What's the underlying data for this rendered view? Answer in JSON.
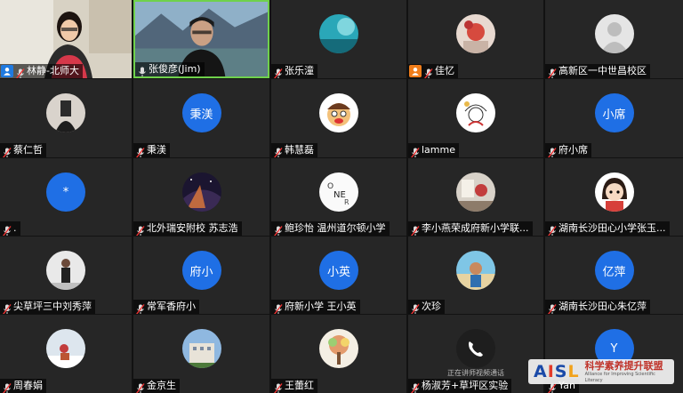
{
  "participants": [
    {
      "name": "林静-北师大",
      "kind": "video-woman",
      "host": true
    },
    {
      "name": "张俊彦(Jim)",
      "kind": "video-man",
      "active": true
    },
    {
      "name": "张乐潼",
      "kind": "photo-cyan"
    },
    {
      "name": "佳忆",
      "kind": "photo-red",
      "cohost": true
    },
    {
      "name": "高新区一中世昌校区",
      "kind": "photo-default"
    },
    {
      "name": "蔡仁哲",
      "kind": "photo-dark"
    },
    {
      "name": "秉渼",
      "kind": "text",
      "initials": "秉渼"
    },
    {
      "name": "韩慧磊",
      "kind": "photo-cartoon"
    },
    {
      "name": "lamme",
      "kind": "photo-sketch"
    },
    {
      "name": "府小席",
      "kind": "text",
      "initials": "小席"
    },
    {
      "name": ".",
      "kind": "text",
      "initials": "*"
    },
    {
      "name": "北外瑞安附校 苏志浩",
      "kind": "photo-sky"
    },
    {
      "name": "鲍珍怡 温州道尔顿小学",
      "kind": "photo-letters"
    },
    {
      "name": "李小燕荣成府新小学联...",
      "kind": "photo-room"
    },
    {
      "name": "湖南长沙田心小学张玉...",
      "kind": "photo-girl"
    },
    {
      "name": "尖草坪三中刘秀萍",
      "kind": "photo-person"
    },
    {
      "name": "常军香府小",
      "kind": "text",
      "initials": "府小"
    },
    {
      "name": "府新小学 王小英",
      "kind": "text",
      "initials": "小英"
    },
    {
      "name": "次珍",
      "kind": "photo-beach"
    },
    {
      "name": "湖南长沙田心朱亿萍",
      "kind": "text",
      "initials": "亿萍"
    },
    {
      "name": "周春娟",
      "kind": "photo-snow"
    },
    {
      "name": "金京生",
      "kind": "photo-building"
    },
    {
      "name": "王蕾红",
      "kind": "photo-tree"
    },
    {
      "name": "杨淑芳+草坪区实验",
      "kind": "photo-phone"
    },
    {
      "name": "Yan",
      "kind": "text",
      "initials": "Y"
    }
  ],
  "overlay_text": "正在讲师视频通话",
  "watermark": {
    "logo_a": "A",
    "logo_i": "I",
    "logo_s": "S",
    "logo_l": "L",
    "title": "科学素养提升联盟",
    "subtitle": "Alliance for Improving Scientific Literacy"
  }
}
